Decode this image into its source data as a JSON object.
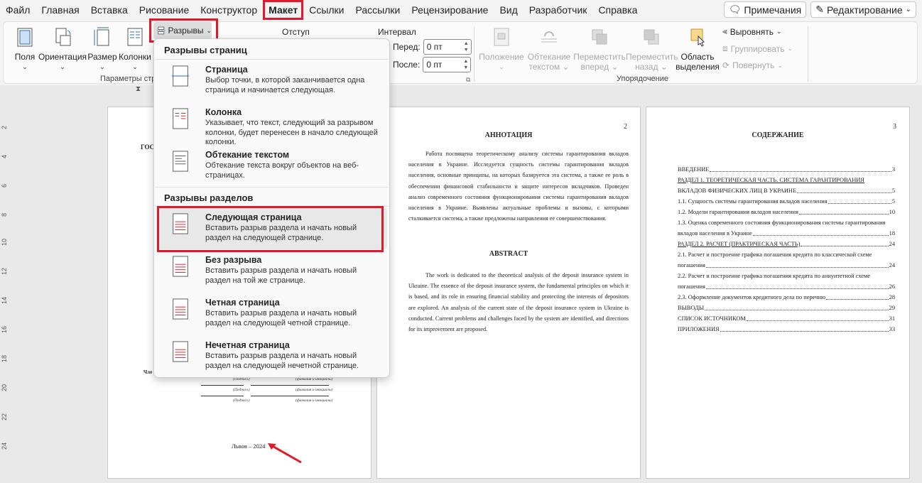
{
  "menu": {
    "tabs": [
      "Файл",
      "Главная",
      "Вставка",
      "Рисование",
      "Конструктор",
      "Макет",
      "Ссылки",
      "Рассылки",
      "Рецензирование",
      "Вид",
      "Разработчик",
      "Справка"
    ],
    "active_tab": "Макет",
    "notes_label": "Примечания",
    "editing_label": "Редактирование"
  },
  "ribbon": {
    "page_setup": {
      "margins": "Поля",
      "orientation": "Ориентация",
      "size": "Размер",
      "columns": "Колонки",
      "breaks": "Разрывы",
      "group_label": "Параметры стра"
    },
    "indent_label": "Отступ",
    "spacing_label": "Интервал",
    "before_label": "Перед:",
    "before_value": "0 пт",
    "after_label": "После:",
    "after_value": "0 пт",
    "arrange": {
      "position": "Положение",
      "wrap_line1": "Обтекание",
      "wrap_line2": "текстом",
      "forward_line1": "Переместить",
      "forward_line2": "вперед",
      "backward_line1": "Переместить",
      "backward_line2": "назад",
      "selection_line1": "Область",
      "selection_line2": "выделения",
      "align": "Выровнять",
      "group": "Группировать",
      "rotate": "Повернуть",
      "group_label": "Упорядочение"
    }
  },
  "dropdown": {
    "page_breaks_header": "Разрывы страниц",
    "section_breaks_header": "Разрывы разделов",
    "items": [
      {
        "title": "Страница",
        "desc": "Выбор точки, в которой заканчивается одна страница и начинается следующая."
      },
      {
        "title": "Колонка",
        "desc": "Указывает, что текст, следующий за разрывом колонки, будет перенесен в начало следующей колонки."
      },
      {
        "title": "Обтекание текстом",
        "desc": "Обтекание текста вокруг объектов на веб-страницах."
      },
      {
        "title": "Следующая страница",
        "desc": "Вставить разрыв раздела и начать новый раздел на следующей странице."
      },
      {
        "title": "Без разрыва",
        "desc": "Вставить разрыв раздела и начать новый раздел на той же странице."
      },
      {
        "title": "Четная страница",
        "desc": "Вставить разрыв раздела и начать новый раздел на следующей четной странице."
      },
      {
        "title": "Нечетная страница",
        "desc": "Вставить разрыв раздела и начать новый раздел на следующей нечетной странице."
      }
    ]
  },
  "ruler": {
    "marks": [
      "2",
      "4",
      "6",
      "8",
      "10",
      "12",
      "14",
      "16",
      "18",
      "20",
      "22",
      "24"
    ]
  },
  "page1": {
    "partial_title": "ГОС",
    "partial_label": "Чле",
    "sig_label": "(Подпись)",
    "name_label": "(фамилия и инициалы)",
    "city_year": "Львов – 2024"
  },
  "page2": {
    "num": "2",
    "annotation_title": "АННОТАЦИЯ",
    "annotation_text": "Работа посвящена теоретическому анализу системы гарантирования вкладов населения в Украине. Исследуется сущность системы гарантирования вкладов населения, основные принципы, на которых базируется эта система, а также ее роль в обеспечении финансовой стабильности и защите интересов вкладчиков. Проведен анализ современного состояния функционирования системы гарантирования вкладов населения в Украине. Выявлены актуальные проблемы и вызовы, с которыми сталкивается система, а также предложены направления ее совершенствования.",
    "abstract_title": "ABSTRACT",
    "abstract_text": "The work is dedicated to the theoretical analysis of the deposit insurance system in Ukraine. The essence of the deposit insurance system, the fundamental principles on which it is based, and its role in ensuring financial stability and protecting the interests of depositors are explored. An analysis of the current state of the deposit insurance system in Ukraine is conducted. Current problems and challenges faced by the system are identified, and directions for its improvement are proposed."
  },
  "page3": {
    "num": "3",
    "title": "СОДЕРЖАНИЕ",
    "toc": [
      {
        "text": "ВВЕДЕНИЕ",
        "page": "3"
      },
      {
        "text": "РАЗДЕЛ 1. ТЕОРЕТИЧЕСКАЯ ЧАСТЬ. СИСТЕМА ГАРАНТИРОВАНИЯ",
        "page": ""
      },
      {
        "text": "ВКЛАДОВ ФИЗИЧЕСКИХ ЛИЦ В УКРАИНЕ",
        "page": "5"
      },
      {
        "text": "1.1. Сущность системы гарантирования вкладов населения",
        "page": "5"
      },
      {
        "text": "1.2. Модели гарантирования вкладов населения",
        "page": "10"
      },
      {
        "text": "1.3. Оценка современного состояния функционирования системы гарантирования",
        "page": ""
      },
      {
        "text": "вкладов населения в Украине",
        "page": "18"
      },
      {
        "text": "РАЗДЕЛ 2. РАСЧЕТ (ПРАКТИЧЕСКАЯ ЧАСТЬ)",
        "page": "24"
      },
      {
        "text": "2.1. Расчет и построение графика погашения кредита по классической схеме",
        "page": ""
      },
      {
        "text": "погашения",
        "page": "24"
      },
      {
        "text": "2.2. Расчет и построение графика погашения кредита по аннуитетной схеме",
        "page": ""
      },
      {
        "text": "погашения",
        "page": "26"
      },
      {
        "text": "2.3. Оформление документов кредитного дела по перечню",
        "page": "28"
      },
      {
        "text": "ВЫВОДЫ",
        "page": "29"
      },
      {
        "text": "СПИСОК ИСТОЧНИКОМ",
        "page": "31"
      },
      {
        "text": "ПРИЛОЖЕНИЯ",
        "page": "33"
      }
    ]
  },
  "colors": {
    "highlight": "#e0192b",
    "icon_blue": "#2b6cb0"
  }
}
